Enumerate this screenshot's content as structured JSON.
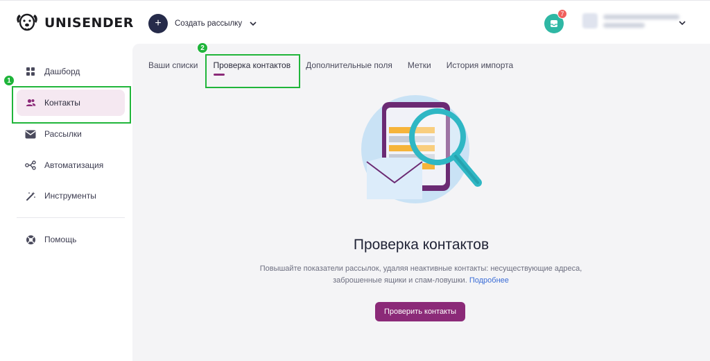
{
  "header": {
    "logo_text": "UNISENDER",
    "create_label": "Создать рассылку",
    "notif_count": "7"
  },
  "sidebar": {
    "items": [
      {
        "label": "Дашборд",
        "icon": "dashboard-grid-icon"
      },
      {
        "label": "Контакты",
        "icon": "contacts-people-icon",
        "active": true
      },
      {
        "label": "Рассылки",
        "icon": "mail-icon"
      },
      {
        "label": "Автоматизация",
        "icon": "automation-nodes-icon"
      },
      {
        "label": "Инструменты",
        "icon": "magic-wand-icon"
      },
      {
        "label": "Помощь",
        "icon": "lifebuoy-icon"
      }
    ]
  },
  "main": {
    "tabs": [
      {
        "label": "Ваши списки"
      },
      {
        "label": "Проверка контактов",
        "active": true
      },
      {
        "label": "Дополнительные поля"
      },
      {
        "label": "Метки"
      },
      {
        "label": "История импорта"
      }
    ],
    "title": "Проверка контактов",
    "desc_text": "Повышайте показатели рассылок, удаляя неактивные контакты: несуществующие адреса, заброшенные ящики и спам-ловушки.",
    "desc_link": "Подробнее",
    "cta_label": "Проверить контакты"
  },
  "annotations": [
    {
      "label": "1"
    },
    {
      "label": "2"
    }
  ],
  "colors": {
    "accent": "#8b2a78",
    "active_bg": "#f5e8f1",
    "annotation": "#20b53a",
    "notif": "#2fb7a4"
  }
}
